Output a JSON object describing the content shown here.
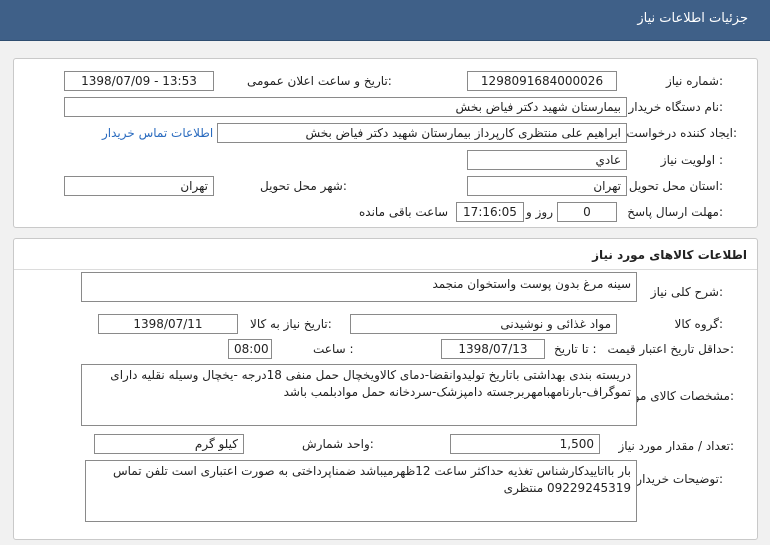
{
  "header": {
    "title": "جزئیات اطلاعات نیاز"
  },
  "info": {
    "need_number_label": "شماره نیاز:",
    "need_number": "1298091684000026",
    "announce_label": "تاریخ و ساعت اعلان عمومی:",
    "announce_value": "1398/07/09 - 13:53",
    "buyer_org_label": "نام دستگاه خریدار:",
    "buyer_org": "بیمارستان شهید دکتر فیاض بخش",
    "requester_label": "ایجاد کننده درخواست:",
    "requester": "ابراهیم علی منتظری کارپرداز بیمارستان شهید دکتر فیاض بخش",
    "contact_link": "اطلاعات تماس خریدار",
    "priority_label": "اولویت نیاز :",
    "priority": "عادي",
    "province_label": "استان محل تحویل:",
    "province": "تهران",
    "city_label": "شهر محل تحویل:",
    "city": "تهران",
    "deadline_label": "مهلت ارسال پاسخ:",
    "deadline_days": "0",
    "days_word": "روز و",
    "deadline_time": "17:16:05",
    "remaining": "ساعت باقی مانده"
  },
  "goods": {
    "title": "اطلاعات کالاهای مورد نیاز",
    "summary_label": "شرح کلی نیاز:",
    "summary": "سینه مرغ بدون پوست واستخوان منجمد",
    "group_label": "گروه کالا:",
    "group": "مواد غذائی و نوشیدنی",
    "need_date_label": "تاریخ نیاز به کالا:",
    "need_date": "1398/07/11",
    "validity_label": "حداقل تاریخ اعتبار قیمت:",
    "until_label": "تا تاریخ :",
    "validity_date": "1398/07/13",
    "time_label": "ساعت :",
    "validity_time": "08:00",
    "specs_label": "مشخصات کالای مورد نیاز:",
    "specs": "دریسته بندی بهداشتی باتاریخ تولیدوانقضا-دمای کالاویخچال حمل منفی 18درجه -یخچال وسیله نقلیه دارای تموگراف-بارنامهبامهربرجسته دامپزشک-سردخانه حمل موادبلمب باشد",
    "qty_label": "تعداد / مقدار مورد نیاز:",
    "qty": "1,500",
    "unit_label": "واحد شمارش:",
    "unit": "کیلو گرم",
    "buyer_notes_label": "توضیحات خریدار:",
    "buyer_notes": "بار بااتاییدکارشناس تغذیه حداکثر ساعت 12ظهرمیباشد ضمناپرداختی به صورت اعتباری است تلفن تماس 09229245319 منتظری"
  }
}
